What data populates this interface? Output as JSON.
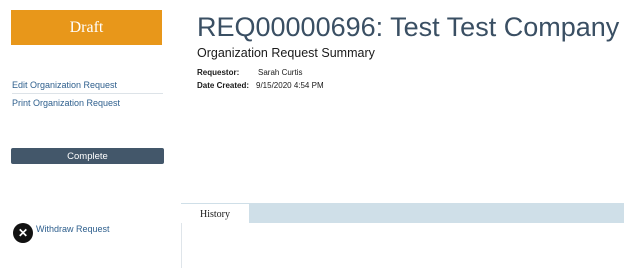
{
  "status": {
    "label": "Draft",
    "color": "#e8971a"
  },
  "sidebar": {
    "links": [
      {
        "label": "Edit Organization Request"
      },
      {
        "label": "Print Organization Request"
      }
    ],
    "complete_label": "Complete",
    "withdraw_label": "Withdraw Request",
    "withdraw_icon": "close-circle-icon"
  },
  "header": {
    "title": "REQ00000696: Test Test Company",
    "subtitle": "Organization Request Summary",
    "requestor_label": "Requestor:",
    "requestor_value": "Sarah Curtis",
    "date_label": "Date Created:",
    "date_value": "9/15/2020 4:54 PM"
  },
  "tabs": [
    {
      "label": "History",
      "active": true
    }
  ]
}
